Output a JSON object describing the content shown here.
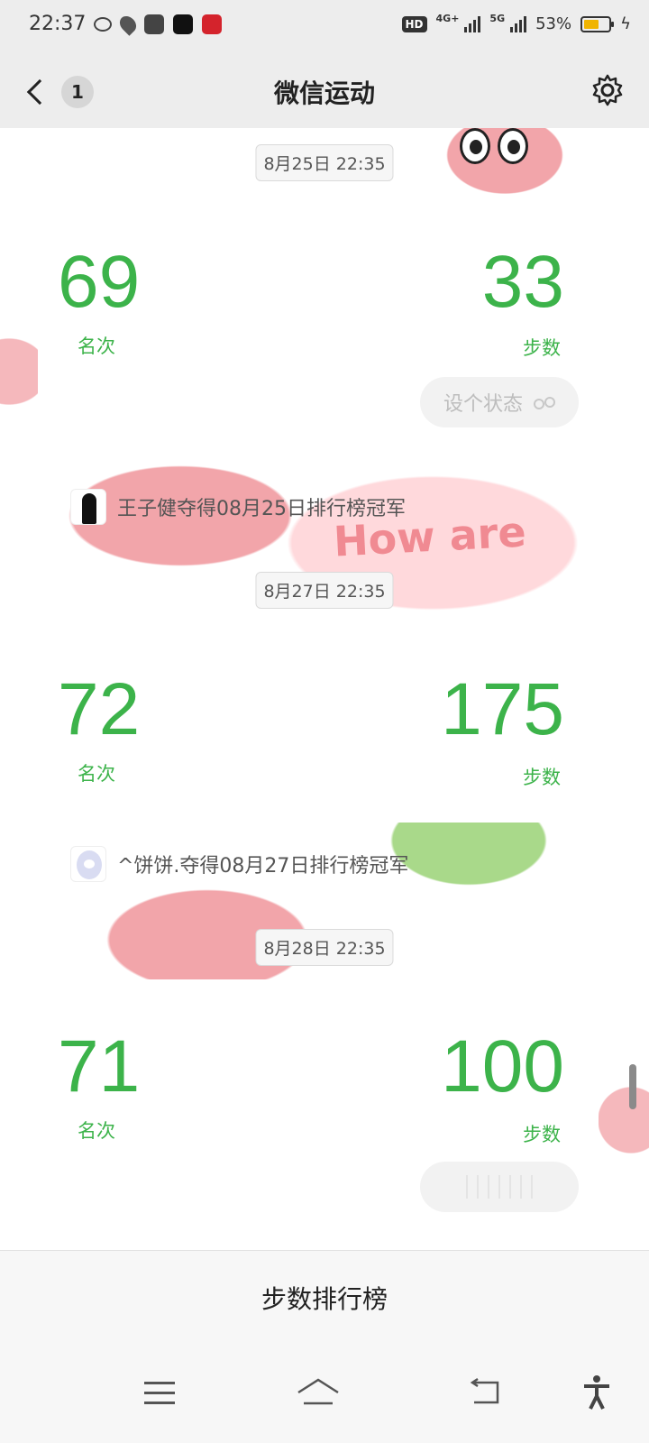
{
  "status_bar": {
    "time": "22:37",
    "hd_label": "HD",
    "net1": "4G+",
    "net2": "5G",
    "battery_percent": "53%",
    "battery_level": 0.53,
    "accent_battery": "#f0b400"
  },
  "header": {
    "title": "微信运动",
    "unread_count": "1"
  },
  "background": {
    "text": "How are"
  },
  "messages": [
    {
      "timestamp": "8月25日 22:35",
      "rank": "69",
      "rank_label": "名次",
      "steps": "33",
      "steps_label": "步数",
      "status_button": "设个状态"
    },
    {
      "timestamp": "8月27日 22:35",
      "rank": "72",
      "rank_label": "名次",
      "steps": "175",
      "steps_label": "步数"
    },
    {
      "timestamp": "8月28日 22:35",
      "rank": "71",
      "rank_label": "名次",
      "steps": "100",
      "steps_label": "步数"
    }
  ],
  "champions": [
    {
      "text": "王子健夺得08月25日排行榜冠军",
      "avatar": "avatar-silhouette"
    },
    {
      "text": "^饼饼.夺得08月27日排行榜冠军",
      "avatar": "avatar-anime"
    }
  ],
  "bottom_tab": {
    "label": "步数排行榜"
  },
  "colors": {
    "accent_green": "#3cb34a",
    "header_bg": "#ededed"
  }
}
